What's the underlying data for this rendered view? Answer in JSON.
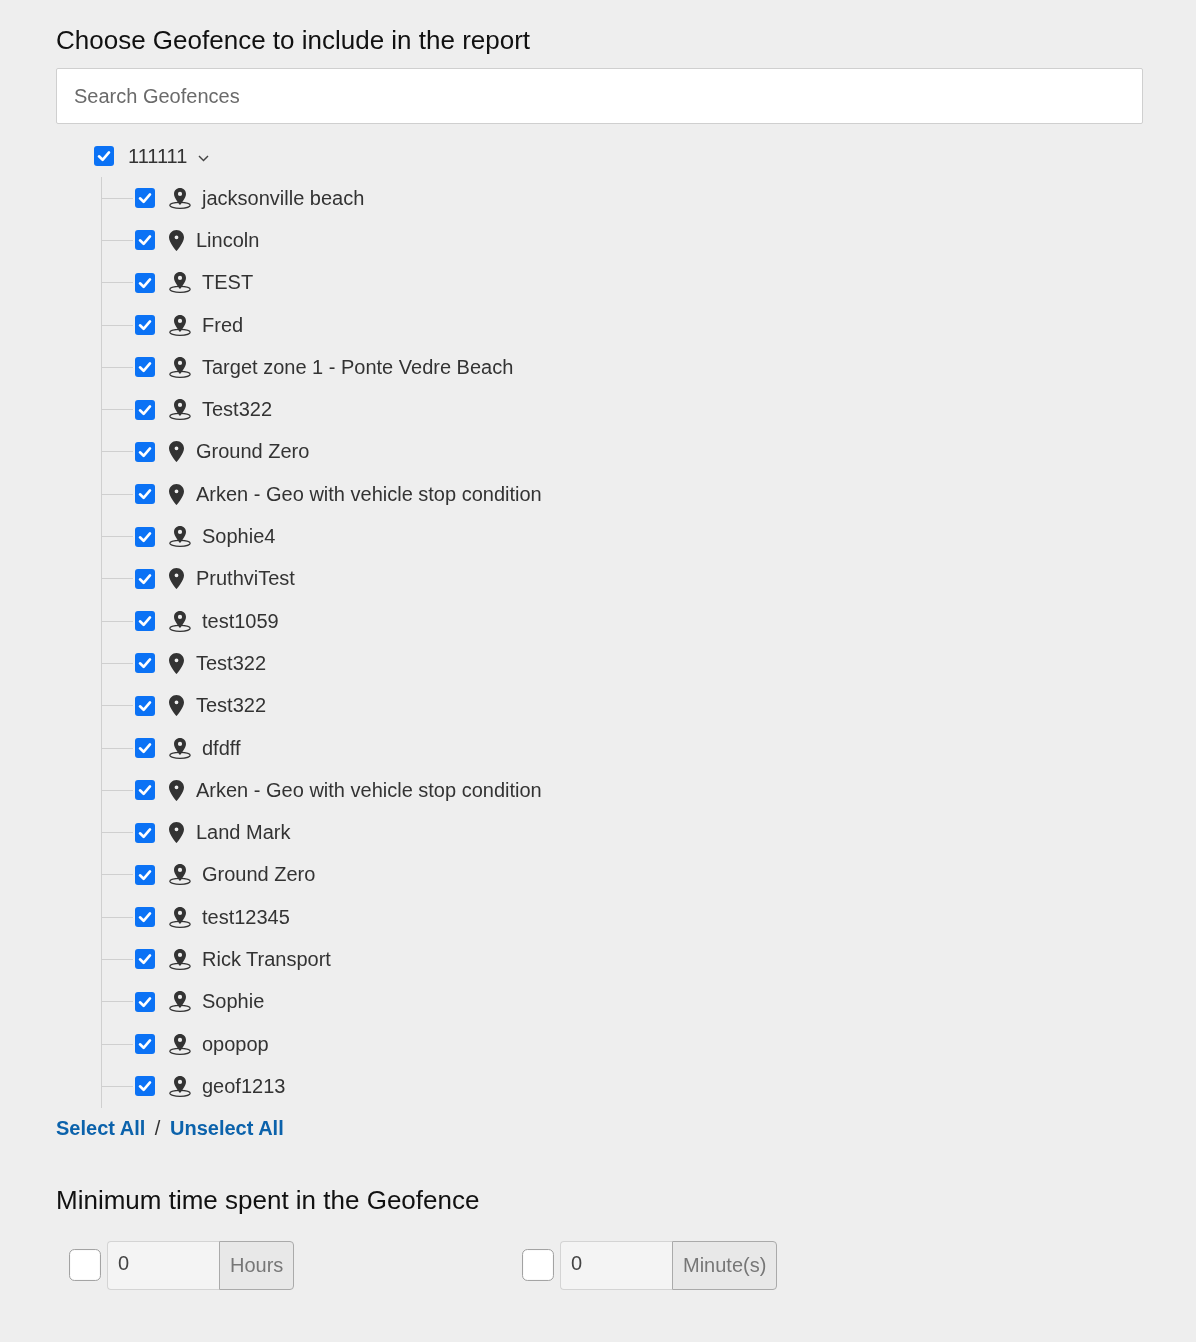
{
  "heading": "Choose Geofence to include in the report",
  "search": {
    "placeholder": "Search Geofences"
  },
  "tree": {
    "label": "111111",
    "checked": true,
    "expanded": true,
    "children": [
      {
        "label": "jacksonville beach",
        "checked": true,
        "kind": "zone"
      },
      {
        "label": "Lincoln",
        "checked": true,
        "kind": "marker"
      },
      {
        "label": "TEST",
        "checked": true,
        "kind": "zone"
      },
      {
        "label": "Fred",
        "checked": true,
        "kind": "zone"
      },
      {
        "label": "Target zone 1 - Ponte Vedre Beach",
        "checked": true,
        "kind": "zone"
      },
      {
        "label": "Test322",
        "checked": true,
        "kind": "zone"
      },
      {
        "label": "Ground Zero",
        "checked": true,
        "kind": "marker"
      },
      {
        "label": "Arken - Geo with vehicle stop condition",
        "checked": true,
        "kind": "marker"
      },
      {
        "label": "Sophie4",
        "checked": true,
        "kind": "zone"
      },
      {
        "label": "PruthviTest",
        "checked": true,
        "kind": "marker"
      },
      {
        "label": "test1059",
        "checked": true,
        "kind": "zone"
      },
      {
        "label": "Test322",
        "checked": true,
        "kind": "marker"
      },
      {
        "label": "Test322",
        "checked": true,
        "kind": "marker"
      },
      {
        "label": "dfdff",
        "checked": true,
        "kind": "zone"
      },
      {
        "label": "Arken - Geo with vehicle stop condition",
        "checked": true,
        "kind": "marker"
      },
      {
        "label": "Land Mark",
        "checked": true,
        "kind": "marker"
      },
      {
        "label": "Ground Zero",
        "checked": true,
        "kind": "zone"
      },
      {
        "label": "test12345",
        "checked": true,
        "kind": "zone"
      },
      {
        "label": "Rick Transport",
        "checked": true,
        "kind": "zone"
      },
      {
        "label": "Sophie",
        "checked": true,
        "kind": "zone"
      },
      {
        "label": "opopop",
        "checked": true,
        "kind": "zone"
      },
      {
        "label": "geof1213",
        "checked": true,
        "kind": "zone"
      }
    ]
  },
  "selection_links": {
    "select_all": "Select All",
    "separator": "/",
    "unselect_all": "Unselect All"
  },
  "min_time": {
    "heading": "Minimum time spent in the Geofence",
    "fields": [
      {
        "checked": false,
        "value": "0",
        "unit": "Hours"
      },
      {
        "checked": false,
        "value": "0",
        "unit": "Minute(s)"
      }
    ]
  }
}
